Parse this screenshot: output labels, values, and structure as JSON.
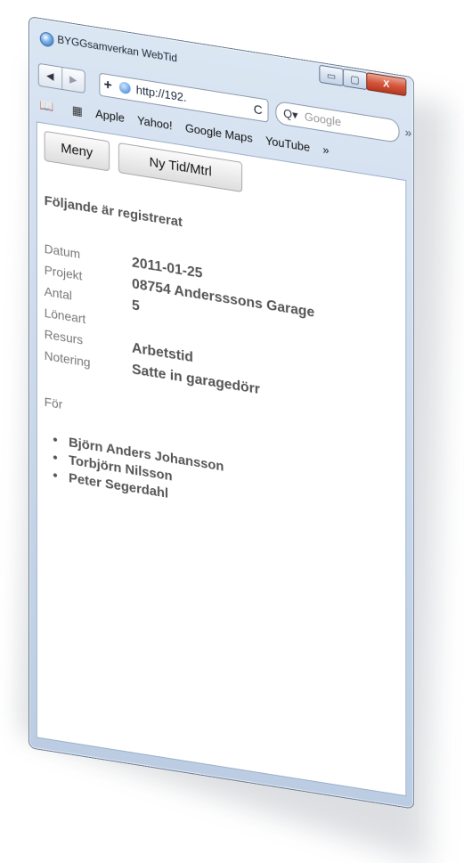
{
  "window": {
    "title": "BYGGsamverkan WebTid",
    "buttons": {
      "minimize": "▭",
      "maximize": "▢",
      "close": "X"
    }
  },
  "toolbar": {
    "back": "◀",
    "forward": "▶",
    "add": "+",
    "url": "http://192.",
    "reload": "C",
    "search_placeholder": "Google",
    "more": "»"
  },
  "bookmarks": {
    "items": [
      "Apple",
      "Yahoo!",
      "Google Maps",
      "YouTube"
    ],
    "more": "»"
  },
  "page": {
    "menu_button": "Meny",
    "new_button": "Ny Tid/Mtrl",
    "heading": "Följande är registrerat",
    "fields": [
      {
        "label": "Datum",
        "value": "2011-01-25"
      },
      {
        "label": "Projekt",
        "value": "08754 Andersssons Garage"
      },
      {
        "label": "Antal",
        "value": "5"
      },
      {
        "label": "Löneart",
        "value": ""
      },
      {
        "label": "Resurs",
        "value": "Arbetstid"
      },
      {
        "label": "Notering",
        "value": "Satte in garagedörr"
      }
    ],
    "for_label": "För",
    "people": [
      "Björn Anders Johansson",
      "Torbjörn Nilsson",
      "Peter Segerdahl"
    ]
  },
  "colors": {
    "close_button": "#c9432a",
    "frame": "#c7d6e9"
  }
}
